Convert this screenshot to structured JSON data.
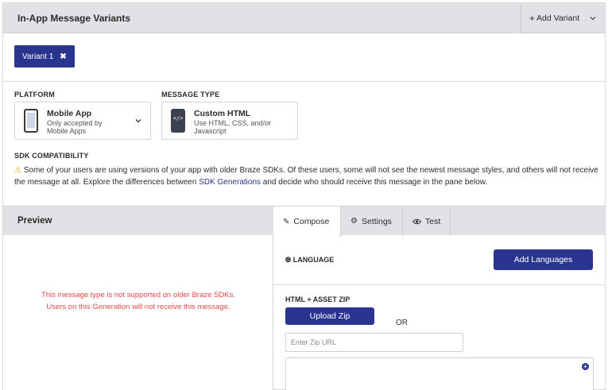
{
  "header": {
    "title": "In-App Message Variants",
    "add_variant_label": "Add Variant",
    "add_variant_plus": "+"
  },
  "variants": [
    {
      "label": "Variant 1",
      "remove_glyph": "✖"
    }
  ],
  "platform": {
    "section_label": "PLATFORM",
    "title": "Mobile App",
    "subtitle_line1": "Only accepted by",
    "subtitle_line2": "Mobile Apps",
    "icon": "phone-icon"
  },
  "message_type": {
    "section_label": "MESSAGE TYPE",
    "title": "Custom HTML",
    "subtitle_line1": "Use HTML, CSS, and/or",
    "subtitle_line2": "Javascript",
    "icon": "code-phone-icon",
    "icon_glyph": "</>"
  },
  "sdk": {
    "section_label": "SDK COMPATIBILITY",
    "warning_icon": "warning-icon",
    "text_before_link": "Some of your users are using versions of your app with older Braze SDKs. Of these users, some will not see the newest message styles, and others will not receive the message at all. Explore the differences between ",
    "link_text": "SDK Generations",
    "text_after_link": " and decide who should receive this message in the pane below."
  },
  "preview": {
    "title": "Preview",
    "message_line1": "This message type is not supported on older Braze SDKs.",
    "message_line2": "Users on this Generation will not receive this message."
  },
  "tabs": [
    {
      "label": "Compose",
      "icon": "pencil-icon",
      "active": true
    },
    {
      "label": "Settings",
      "icon": "gear-icon",
      "active": false
    },
    {
      "label": "Test",
      "icon": "eye-icon",
      "active": false
    }
  ],
  "compose": {
    "language_label": "LANGUAGE",
    "add_languages_label": "Add Languages",
    "html_asset_label": "HTML + ASSET ZIP",
    "upload_zip_label": "Upload Zip",
    "or_text": "OR",
    "zip_url_placeholder": "Enter Zip URL",
    "zip_url_value": ""
  },
  "colors": {
    "accent": "#2a3590",
    "header_bg": "#e2e2e6",
    "error_text": "#e04a4a",
    "warning": "#e69a18"
  }
}
